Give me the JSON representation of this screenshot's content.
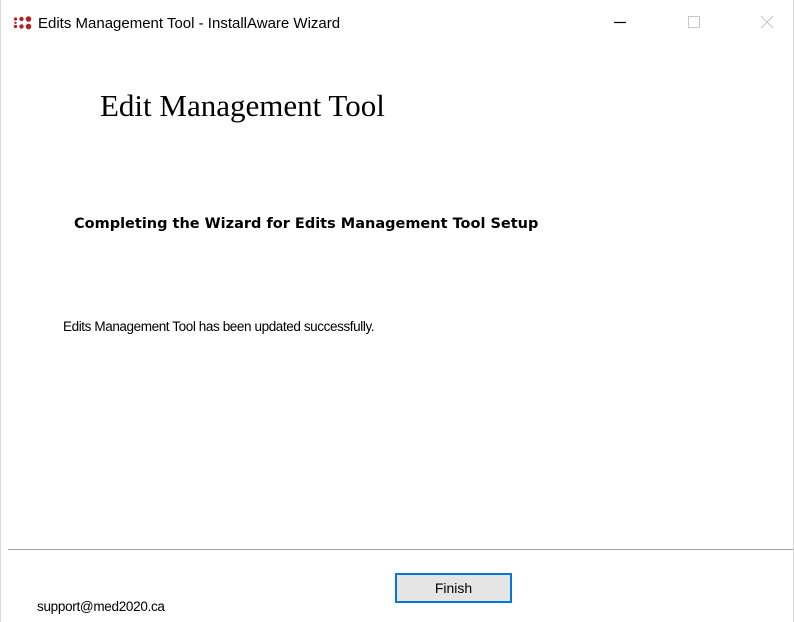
{
  "window": {
    "title": "Edits Management Tool - InstallAware Wizard",
    "app_icon": "installaware-dots-icon",
    "controls": {
      "minimize_icon": "minimize-icon",
      "maximize_icon": "maximize-icon",
      "close_icon": "close-icon"
    }
  },
  "header": {
    "product_title": "Edit Management Tool"
  },
  "body": {
    "heading": "Completing the Wizard for Edits Management Tool Setup",
    "message": "Edits Management Tool  has been updated successfully."
  },
  "footer": {
    "support_email": "support@med2020.ca",
    "finish_label": "Finish"
  },
  "colors": {
    "icon_red": "#b22222",
    "focus_blue": "#0078d7",
    "button_face": "#e5e5e5"
  }
}
